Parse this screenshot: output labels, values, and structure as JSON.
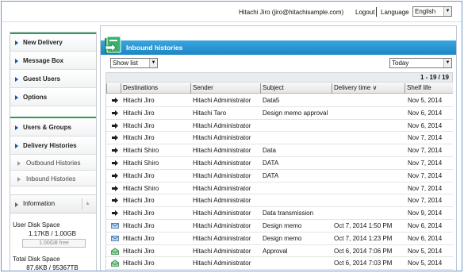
{
  "topbar": {
    "user": "Hitachi Jiro (jiro@hitachisample.com)",
    "logout": "Logout",
    "language_label": "Language",
    "language_value": "English"
  },
  "sidebar": {
    "items": [
      {
        "label": "New Delivery"
      },
      {
        "label": "Message Box"
      },
      {
        "label": "Guest Users"
      },
      {
        "label": "Options"
      },
      {
        "label": "Users & Groups"
      },
      {
        "label": "Delivery Histories"
      },
      {
        "label": "Outbound Histories"
      },
      {
        "label": "Inbound Histories"
      }
    ],
    "information": "Information",
    "user_disk_label": "User Disk Space",
    "user_disk_value": "1.17KB / 1.00GB",
    "user_disk_free": "1.00GB free",
    "user_disk_used_fraction": 0.0,
    "total_disk_label": "Total Disk Space",
    "total_disk_value": "87.6KB / 95367TB"
  },
  "main": {
    "title": "Inbound histories",
    "show_select": "Show list",
    "period_select": "Today",
    "count": "1 - 19 / 19",
    "columns": [
      "Destinations",
      "Sender",
      "Subject",
      "Delivery time ∨",
      "Shelf life"
    ],
    "rows": [
      {
        "icon": "arrow-icon",
        "dest": "Hitachi Jiro",
        "sender": "Hitachi Administrator",
        "subject": "Data5",
        "time": "",
        "shelf": "Nov 5, 2014"
      },
      {
        "icon": "arrow-icon",
        "dest": "Hitachi Jiro",
        "sender": "Hitachi Taro",
        "subject": "Design memo approval",
        "time": "",
        "shelf": "Nov 6, 2014"
      },
      {
        "icon": "arrow-icon",
        "dest": "Hitachi Jiro",
        "sender": "Hitachi Administrator",
        "subject": "",
        "time": "",
        "shelf": "Nov 6, 2014"
      },
      {
        "icon": "arrow-icon",
        "dest": "Hitachi Jiro",
        "sender": "Hitachi Administrator",
        "subject": "",
        "time": "",
        "shelf": "Nov 7, 2014"
      },
      {
        "icon": "arrow-icon",
        "dest": "Hitachi Shiro",
        "sender": "Hitachi Administrator",
        "subject": "Data",
        "time": "",
        "shelf": "Nov 7, 2014"
      },
      {
        "icon": "arrow-icon",
        "dest": "Hitachi Shiro",
        "sender": "Hitachi Administrator",
        "subject": "DATA",
        "time": "",
        "shelf": "Nov 7, 2014"
      },
      {
        "icon": "arrow-icon",
        "dest": "Hitachi Jiro",
        "sender": "Hitachi Administrator",
        "subject": "DATA",
        "time": "",
        "shelf": "Nov 7, 2014"
      },
      {
        "icon": "arrow-icon",
        "dest": "Hitachi Shiro",
        "sender": "Hitachi Administrator",
        "subject": "",
        "time": "",
        "shelf": "Nov 7, 2014"
      },
      {
        "icon": "arrow-icon",
        "dest": "Hitachi Jiro",
        "sender": "Hitachi Administrator",
        "subject": "",
        "time": "",
        "shelf": "Nov 7, 2014"
      },
      {
        "icon": "arrow-icon",
        "dest": "Hitachi Jiro",
        "sender": "Hitachi Administrator",
        "subject": "Data transmission",
        "time": "",
        "shelf": "Nov 9, 2014"
      },
      {
        "icon": "mail-icon",
        "dest": "Hitachi Jiro",
        "sender": "Hitachi Administrator",
        "subject": "Design memo",
        "time": "Oct 7, 2014 1:50 PM",
        "shelf": "Nov 6, 2014"
      },
      {
        "icon": "mail-icon",
        "dest": "Hitachi Jiro",
        "sender": "Hitachi Administrator",
        "subject": "Design memo",
        "time": "Oct 7, 2014 1:23 PM",
        "shelf": "Nov 6, 2014"
      },
      {
        "icon": "open-mail-icon",
        "dest": "Hitachi Jiro",
        "sender": "Hitachi Administrator",
        "subject": "Approval",
        "time": "Oct 6, 2014 7:06 PM",
        "shelf": "Nov 5, 2014"
      },
      {
        "icon": "open-mail-icon",
        "dest": "Hitachi Jiro",
        "sender": "Hitachi Administrator",
        "subject": "",
        "time": "Oct 6, 2014 7:03 PM",
        "shelf": "Nov 5, 2014"
      },
      {
        "icon": "open-mail-icon",
        "dest": "Hitachi Jiro",
        "sender": "Hitachi Administrator",
        "subject": "",
        "time": "Oct 6, 2014 7:00 PM",
        "shelf": "Nov 5, 2014"
      }
    ]
  },
  "colors": {
    "panel_header": "#2595d3",
    "nav_accent": "#1a52a8",
    "green_bar": "#21a05c"
  }
}
